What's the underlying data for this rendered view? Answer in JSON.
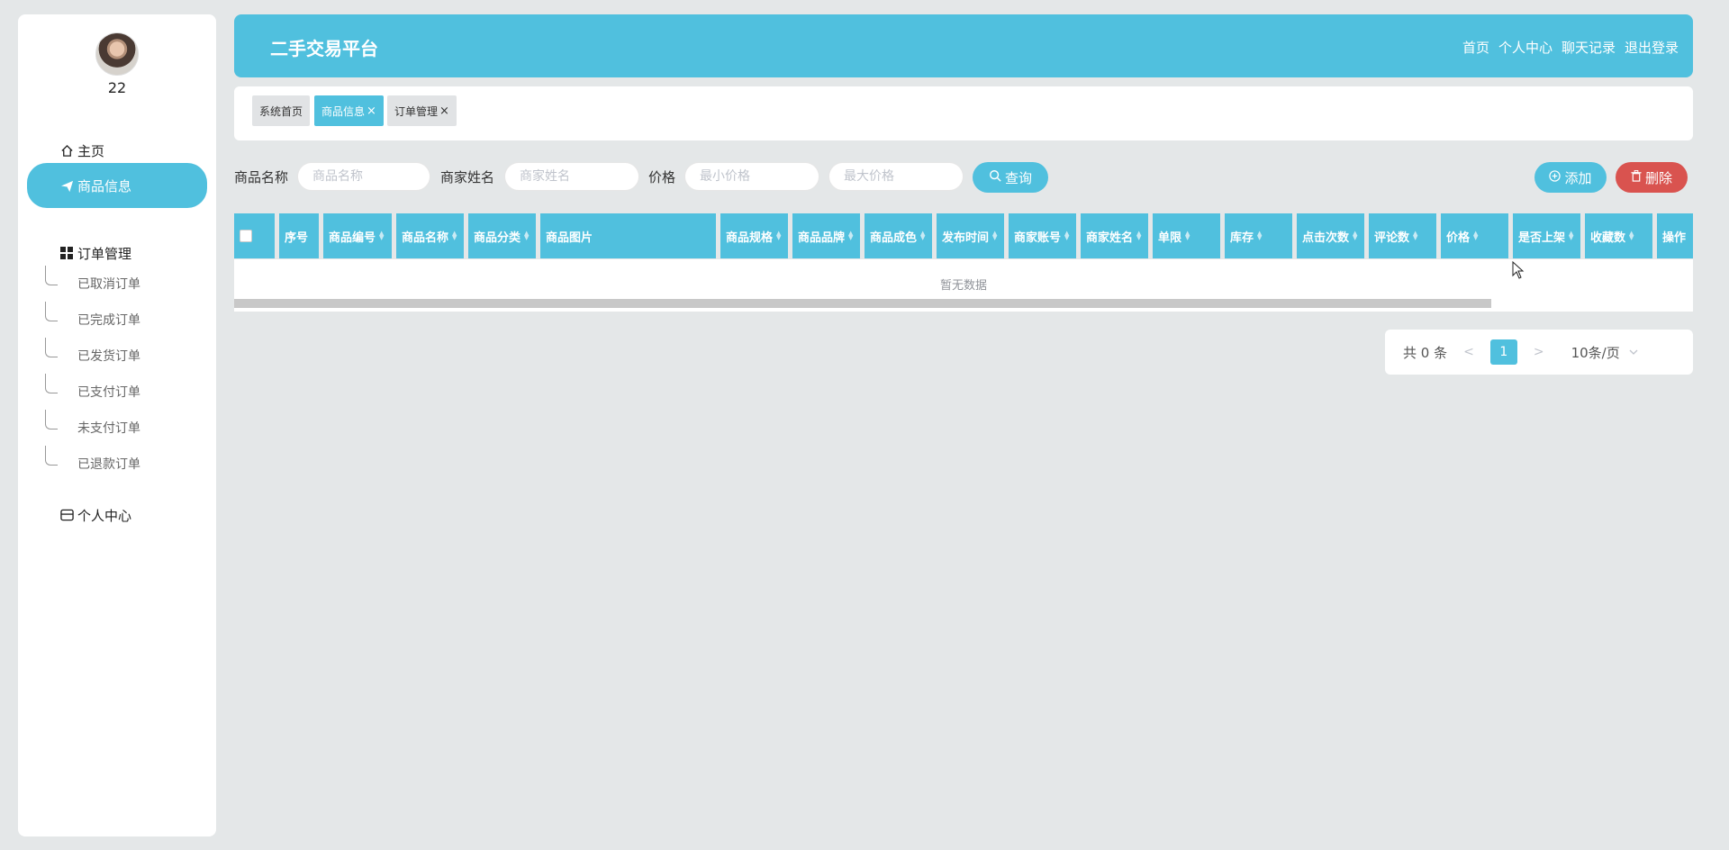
{
  "sidebar": {
    "username": "22",
    "items": [
      {
        "label": "主页",
        "icon": "home-icon"
      },
      {
        "label": "商品信息",
        "icon": "send-icon"
      },
      {
        "label": "订单管理",
        "icon": "grid-icon"
      },
      {
        "label": "个人中心",
        "icon": "card-icon"
      }
    ],
    "order_sub": [
      "已取消订单",
      "已完成订单",
      "已发货订单",
      "已支付订单",
      "未支付订单",
      "已退款订单"
    ]
  },
  "header": {
    "title": "二手交易平台",
    "links": [
      "首页",
      "个人中心",
      "聊天记录",
      "退出登录"
    ]
  },
  "tabs": [
    {
      "label": "系统首页",
      "closable": false
    },
    {
      "label": "商品信息",
      "closable": true
    },
    {
      "label": "订单管理",
      "closable": true
    }
  ],
  "tab_close_glyph": "×",
  "filters": {
    "name_label": "商品名称",
    "name_placeholder": "商品名称",
    "merchant_label": "商家姓名",
    "merchant_placeholder": "商家姓名",
    "price_label": "价格",
    "min_placeholder": "最小价格",
    "max_placeholder": "最大价格",
    "query_button": "查询",
    "add_button": "添加",
    "delete_button": "删除"
  },
  "table": {
    "columns": [
      "序号",
      "商品编号",
      "商品名称",
      "商品分类",
      "商品图片",
      "商品规格",
      "商品品牌",
      "商品成色",
      "发布时间",
      "商家账号",
      "商家姓名",
      "单限",
      "库存",
      "点击次数",
      "评论数",
      "价格",
      "是否上架",
      "收藏数",
      "操作"
    ],
    "empty_text": "暂无数据"
  },
  "pagination": {
    "total_text": "共 0 条",
    "prev": "<",
    "current_page": "1",
    "next": ">",
    "page_size": "10条/页"
  },
  "colors": {
    "primary": "#50c0de",
    "danger": "#d9534f",
    "background": "#e4e7e8"
  }
}
